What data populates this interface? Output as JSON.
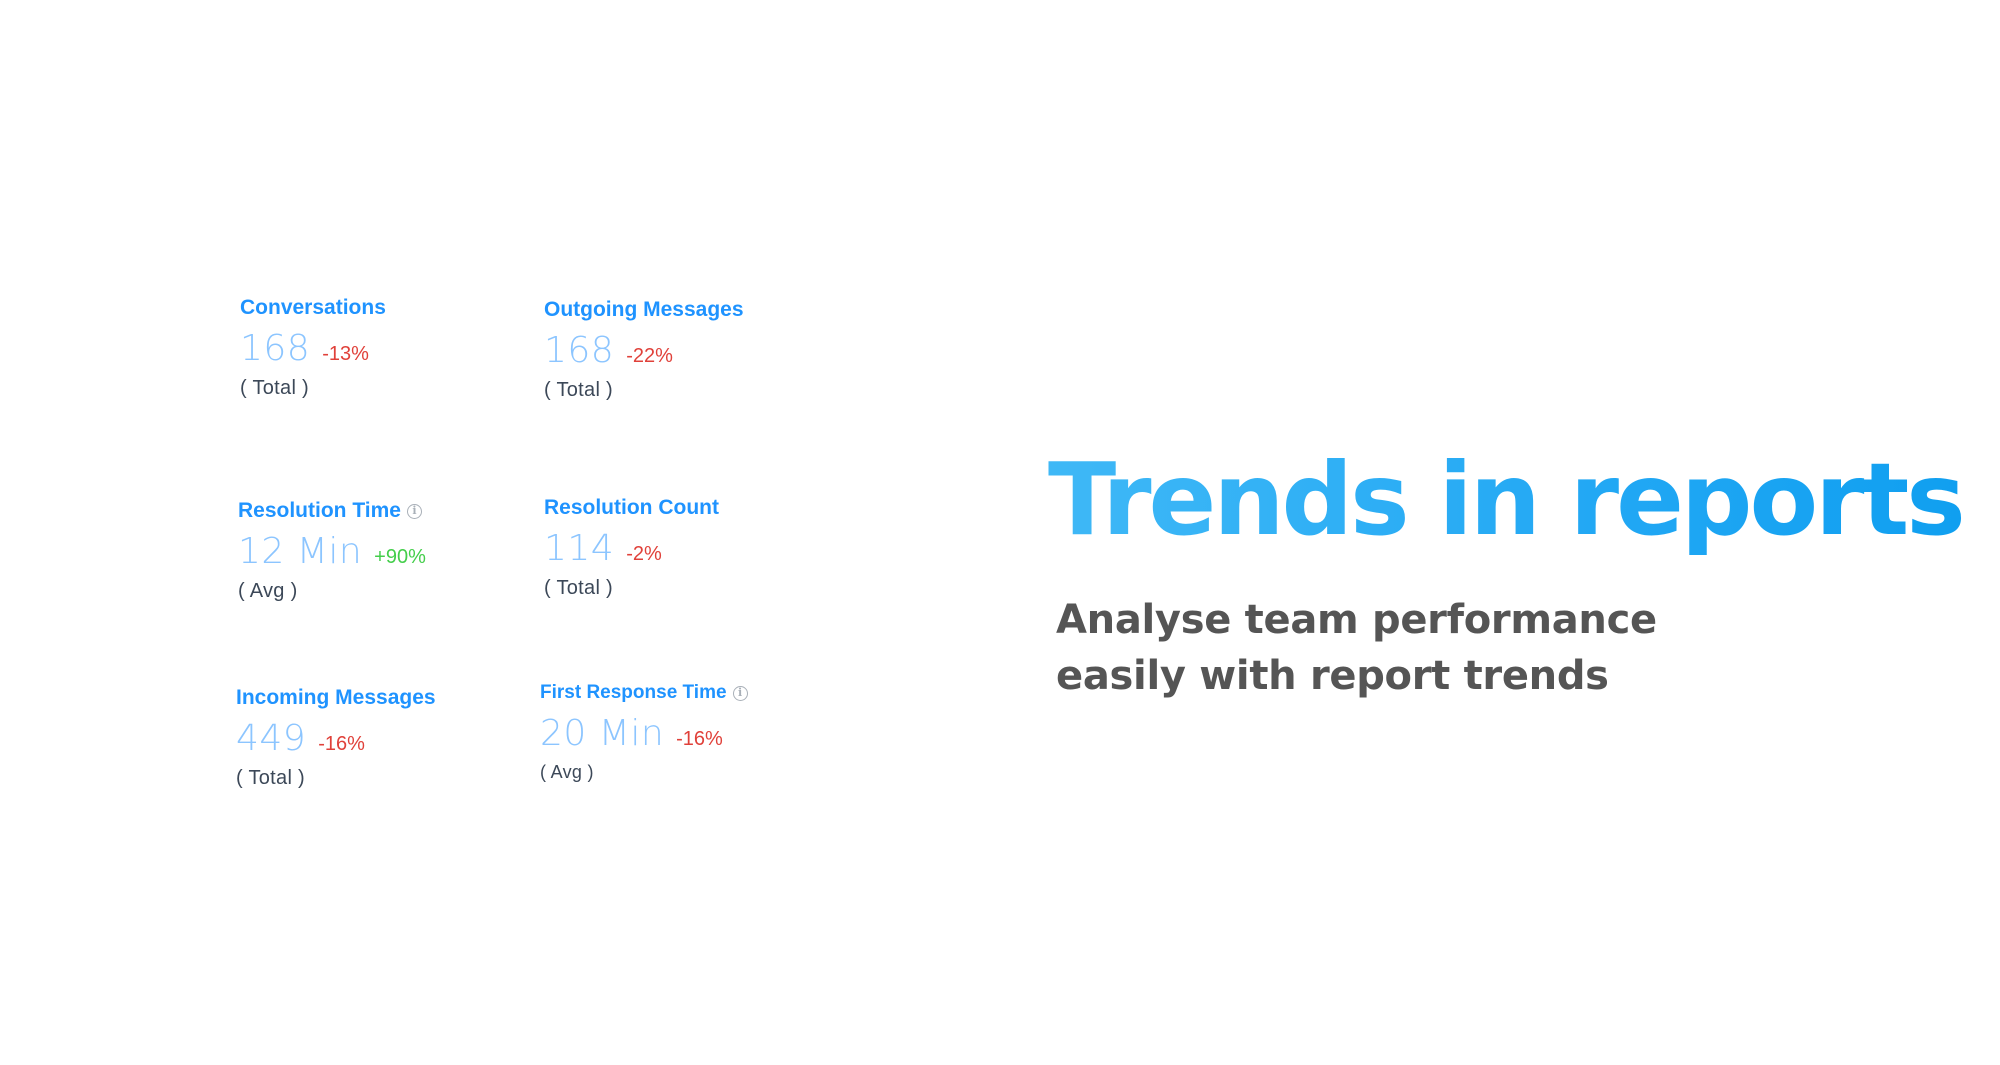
{
  "metrics": [
    {
      "title": "Conversations",
      "value": "168",
      "change": "-13%",
      "trend": "down",
      "basis": "( Total )",
      "info": false
    },
    {
      "title": "Outgoing Messages",
      "value": "168",
      "change": "-22%",
      "trend": "down",
      "basis": "( Total )",
      "info": false
    },
    {
      "title": "Resolution Time",
      "value": "12 Min",
      "change": "+90%",
      "trend": "up",
      "basis": "( Avg )",
      "info": true
    },
    {
      "title": "Resolution Count",
      "value": "114",
      "change": "-2%",
      "trend": "down",
      "basis": "( Total )",
      "info": false
    },
    {
      "title": "Incoming Messages",
      "value": "449",
      "change": "-16%",
      "trend": "down",
      "basis": "( Total )",
      "info": false
    },
    {
      "title": "First Response Time",
      "value": "20 Min",
      "change": "-16%",
      "trend": "down",
      "basis": "( Avg )",
      "info": true
    }
  ],
  "icons": {
    "info": "info-circle-icon"
  },
  "colors": {
    "accent": "#1f93ff",
    "value": "#8cc5ff",
    "negative": "#e0413a",
    "positive": "#44ce4b",
    "heading_gradient": [
      "#3fb8f6",
      "#109ff0"
    ],
    "subheading": "#555555"
  },
  "hero": {
    "title": "Trends in reports",
    "subtitle": "Analyse team performance easily with report trends"
  }
}
